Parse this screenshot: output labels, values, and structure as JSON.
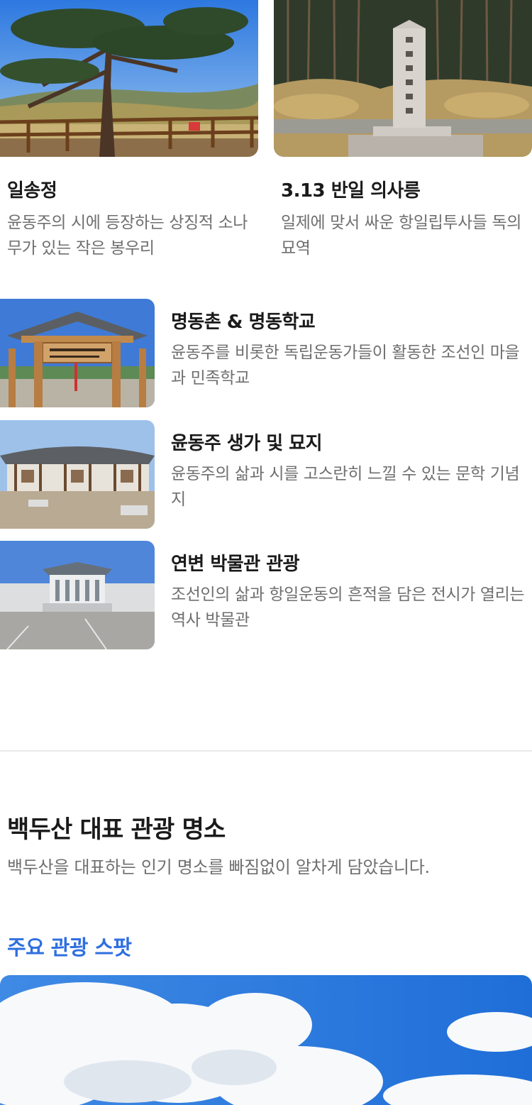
{
  "top_cards": [
    {
      "title": "일송정",
      "desc": "윤동주의 시에 등장하는 상징적 소나무가 있는 작은 봉우리",
      "image": "pine-tree-pavilion-photo"
    },
    {
      "title": "3.13 반일 의사릉",
      "desc": "일제에 맞서 싸운 항일립투사들 독의 묘역",
      "image": "monument-tomb-photo"
    }
  ],
  "list": [
    {
      "title": "명동촌 & 명동학교",
      "desc": "윤동주를 비롯한 독립운동가들이 활동한 조선인 마을과 민족학교",
      "image": "myeongdong-gate-photo"
    },
    {
      "title": "윤동주 생가 및 묘지",
      "desc": "윤동주의 삶과 시를 고스란히 느낄 수 있는 문학 기념지",
      "image": "traditional-house-photo"
    },
    {
      "title": "연변 박물관 관광",
      "desc": "조선인의 삶과 항일운동의 흔적을 담은 전시가 열리는 역사 박물관",
      "image": "museum-photo"
    }
  ],
  "section": {
    "title": "백두산 대표 관광 명소",
    "subtitle": "백두산을 대표하는 인기 명소를 빠짐없이 알차게 담았습니다.",
    "spot_label": "주요 관광 스팟",
    "hero_image": "sky-clouds-photo"
  },
  "colors": {
    "accent": "#2f6fe0",
    "muted_text": "#6f6f6f",
    "divider": "#e9e9e9"
  }
}
